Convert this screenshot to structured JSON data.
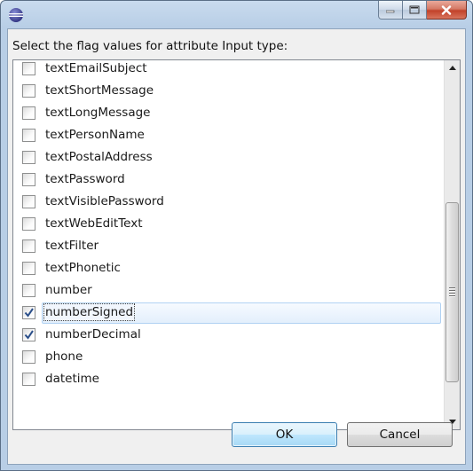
{
  "dialog": {
    "prompt": "Select the flag values for attribute Input type:"
  },
  "flags": [
    {
      "label": "textEmailSubject",
      "checked": false
    },
    {
      "label": "textShortMessage",
      "checked": false
    },
    {
      "label": "textLongMessage",
      "checked": false
    },
    {
      "label": "textPersonName",
      "checked": false
    },
    {
      "label": "textPostalAddress",
      "checked": false
    },
    {
      "label": "textPassword",
      "checked": false
    },
    {
      "label": "textVisiblePassword",
      "checked": false
    },
    {
      "label": "textWebEditText",
      "checked": false
    },
    {
      "label": "textFilter",
      "checked": false
    },
    {
      "label": "textPhonetic",
      "checked": false
    },
    {
      "label": "number",
      "checked": false
    },
    {
      "label": "numberSigned",
      "checked": true,
      "selected": true
    },
    {
      "label": "numberDecimal",
      "checked": true
    },
    {
      "label": "phone",
      "checked": false
    },
    {
      "label": "datetime",
      "checked": false
    }
  ],
  "buttons": {
    "ok": "OK",
    "cancel": "Cancel"
  },
  "colors": {
    "selection_border": "#b1d2f3",
    "checkmark": "#2b4f8a",
    "close_button": "#c2422a"
  }
}
